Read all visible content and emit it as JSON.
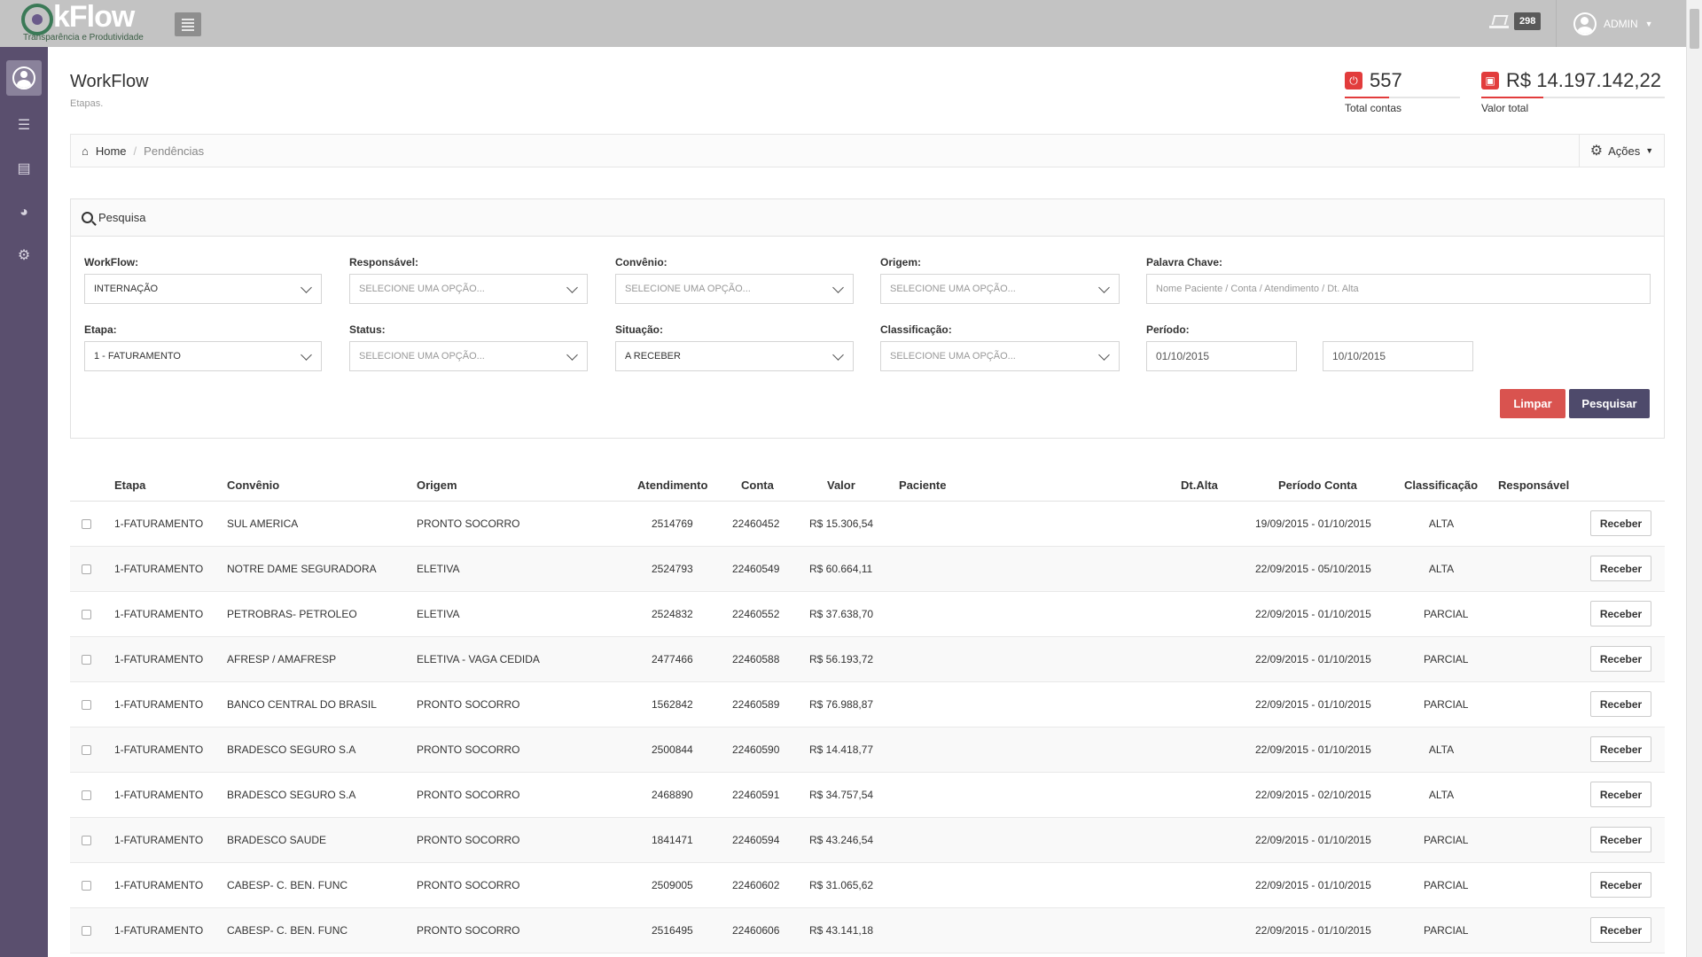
{
  "header": {
    "logo_text": "kFlow",
    "logo_subtitle": "Transparência e Produtividade",
    "notification_count": "298",
    "user_name": "ADMIN"
  },
  "page": {
    "title": "WorkFlow",
    "subtitle": "Etapas."
  },
  "stats": [
    {
      "value": "557",
      "label": "Total contas",
      "icon": "alert-icon"
    },
    {
      "value": "R$ 14.197.142,22",
      "label": "Valor total",
      "icon": "lock-icon"
    }
  ],
  "breadcrumb": {
    "home": "Home",
    "current": "Pendências",
    "actions_label": "Ações"
  },
  "search": {
    "title": "Pesquisa",
    "workflow_label": "WorkFlow:",
    "workflow_value": "INTERNAÇÃO",
    "responsavel_label": "Responsável:",
    "responsavel_value": "SELECIONE UMA OPÇÃO...",
    "convenio_label": "Convênio:",
    "convenio_value": "SELECIONE UMA OPÇÃO...",
    "origem_label": "Origem:",
    "origem_value": "SELECIONE UMA OPÇÃO...",
    "palavra_label": "Palavra Chave:",
    "palavra_placeholder": "Nome Paciente / Conta / Atendimento / Dt. Alta",
    "etapa_label": "Etapa:",
    "etapa_value": "1 - FATURAMENTO",
    "status_label": "Status:",
    "status_value": "SELECIONE UMA OPÇÃO...",
    "situacao_label": "Situação:",
    "situacao_value": "A RECEBER",
    "classificacao_label": "Classificação:",
    "classificacao_value": "SELECIONE UMA OPÇÃO...",
    "periodo_label": "Período:",
    "periodo_inicio": "01/10/2015",
    "periodo_fim": "10/10/2015",
    "limpar_label": "Limpar",
    "pesquisar_label": "Pesquisar"
  },
  "table": {
    "headers": {
      "etapa": "Etapa",
      "convenio": "Convênio",
      "origem": "Origem",
      "atendimento": "Atendimento",
      "conta": "Conta",
      "valor": "Valor",
      "paciente": "Paciente",
      "dtalta": "Dt.Alta",
      "periodo": "Período Conta",
      "classificacao": "Classificação",
      "responsavel": "Responsável"
    },
    "action_label": "Receber",
    "rows": [
      {
        "etapa": "1-FATURAMENTO",
        "convenio": "SUL AMERICA",
        "origem": "PRONTO SOCORRO",
        "atendimento": "2514769",
        "conta": "22460452",
        "valor": "R$ 15.306,54",
        "periodo": "19/09/2015 - 01/10/2015",
        "classificacao": "ALTA"
      },
      {
        "etapa": "1-FATURAMENTO",
        "convenio": "NOTRE DAME SEGURADORA",
        "origem": "ELETIVA",
        "atendimento": "2524793",
        "conta": "22460549",
        "valor": "R$ 60.664,11",
        "periodo": "22/09/2015 - 05/10/2015",
        "classificacao": "ALTA"
      },
      {
        "etapa": "1-FATURAMENTO",
        "convenio": "PETROBRAS- PETROLEO",
        "origem": "ELETIVA",
        "atendimento": "2524832",
        "conta": "22460552",
        "valor": "R$ 37.638,70",
        "periodo": "22/09/2015 - 01/10/2015",
        "classificacao": "PARCIAL"
      },
      {
        "etapa": "1-FATURAMENTO",
        "convenio": "AFRESP / AMAFRESP",
        "origem": "ELETIVA - VAGA CEDIDA",
        "atendimento": "2477466",
        "conta": "22460588",
        "valor": "R$ 56.193,72",
        "periodo": "22/09/2015 - 01/10/2015",
        "classificacao": "PARCIAL"
      },
      {
        "etapa": "1-FATURAMENTO",
        "convenio": "BANCO CENTRAL DO BRASIL",
        "origem": "PRONTO SOCORRO",
        "atendimento": "1562842",
        "conta": "22460589",
        "valor": "R$ 76.988,87",
        "periodo": "22/09/2015 - 01/10/2015",
        "classificacao": "PARCIAL"
      },
      {
        "etapa": "1-FATURAMENTO",
        "convenio": "BRADESCO SEGURO S.A",
        "origem": "PRONTO SOCORRO",
        "atendimento": "2500844",
        "conta": "22460590",
        "valor": "R$ 14.418,77",
        "periodo": "22/09/2015 - 01/10/2015",
        "classificacao": "ALTA"
      },
      {
        "etapa": "1-FATURAMENTO",
        "convenio": "BRADESCO SEGURO S.A",
        "origem": "PRONTO SOCORRO",
        "atendimento": "2468890",
        "conta": "22460591",
        "valor": "R$ 34.757,54",
        "periodo": "22/09/2015 - 02/10/2015",
        "classificacao": "ALTA"
      },
      {
        "etapa": "1-FATURAMENTO",
        "convenio": "BRADESCO SAUDE",
        "origem": "PRONTO SOCORRO",
        "atendimento": "1841471",
        "conta": "22460594",
        "valor": "R$ 43.246,54",
        "periodo": "22/09/2015 - 01/10/2015",
        "classificacao": "PARCIAL"
      },
      {
        "etapa": "1-FATURAMENTO",
        "convenio": "CABESP- C. BEN. FUNC",
        "origem": "PRONTO SOCORRO",
        "atendimento": "2509005",
        "conta": "22460602",
        "valor": "R$ 31.065,62",
        "periodo": "22/09/2015 - 01/10/2015",
        "classificacao": "PARCIAL"
      },
      {
        "etapa": "1-FATURAMENTO",
        "convenio": "CABESP- C. BEN. FUNC",
        "origem": "PRONTO SOCORRO",
        "atendimento": "2516495",
        "conta": "22460606",
        "valor": "R$ 43.141,18",
        "periodo": "22/09/2015 - 01/10/2015",
        "classificacao": "PARCIAL"
      }
    ]
  }
}
